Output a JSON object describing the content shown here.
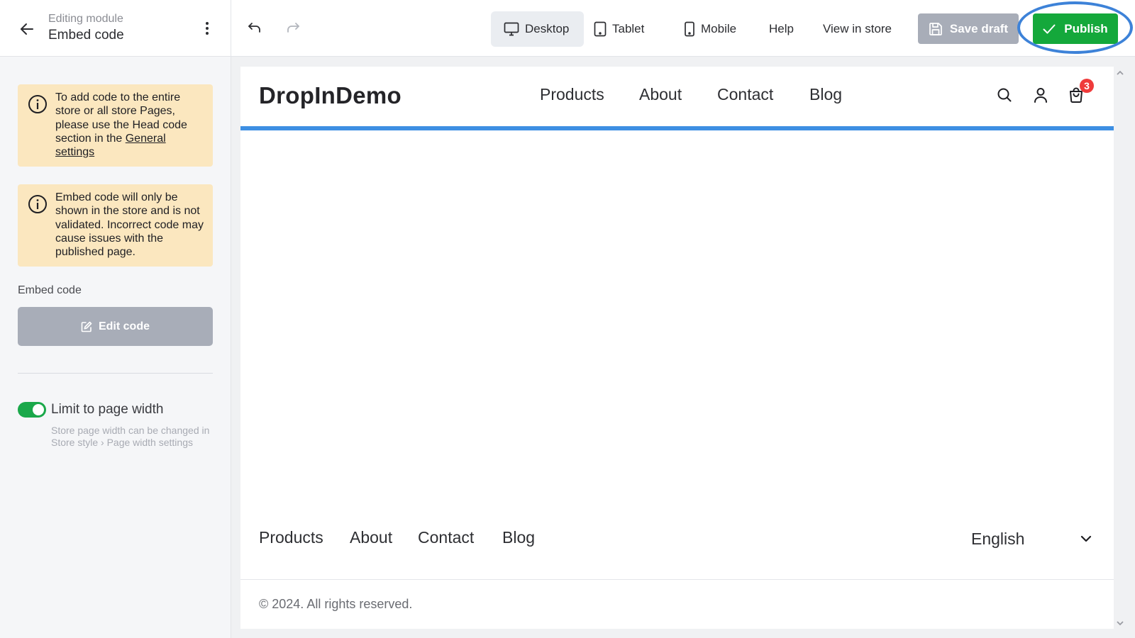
{
  "sidebar": {
    "subtitle": "Editing module",
    "title": "Embed code",
    "notice1": {
      "text_before": "To add code to the entire store or all store Pages, please use the Head code section in the ",
      "link": "General settings"
    },
    "notice2": {
      "text": "Embed code will only be shown in the store and is not validated. Incorrect code may cause issues with the published page."
    },
    "embed_label": "Embed code",
    "edit_button": "Edit code",
    "toggle": {
      "label": "Limit to page width",
      "on": true,
      "help": "Store page width can be changed in Store style › Page width settings"
    }
  },
  "toolbar": {
    "desktop": "Desktop",
    "tablet": "Tablet",
    "mobile": "Mobile",
    "help": "Help",
    "view_in_store": "View in store",
    "save_draft": "Save draft",
    "publish": "Publish"
  },
  "preview": {
    "brand": "DropInDemo",
    "nav": [
      "Products",
      "About",
      "Contact",
      "Blog"
    ],
    "cart_count": "3",
    "footer_nav": [
      "Products",
      "About",
      "Contact",
      "Blog"
    ],
    "language": "English",
    "copyright": "© 2024. All rights reserved."
  },
  "colors": {
    "publish": "#14a83b",
    "notice_bg": "#fbe7bf",
    "accent_bar": "#3d8fe3",
    "disabled_button": "#a8adb8",
    "highlight_ring": "#3d82d8",
    "badge": "#ef3b3b"
  },
  "icons": {
    "back": "arrow-left-icon",
    "menu": "kebab-icon",
    "info": "info-icon",
    "edit": "edit-icon",
    "undo": "undo-icon",
    "redo": "redo-icon",
    "desktop": "monitor-icon",
    "tablet": "tablet-icon",
    "mobile": "phone-icon",
    "save": "floppy-icon",
    "publish": "check-icon",
    "search": "search-icon",
    "account": "user-icon",
    "cart": "cart-icon",
    "language": "chevron-down-icon"
  }
}
